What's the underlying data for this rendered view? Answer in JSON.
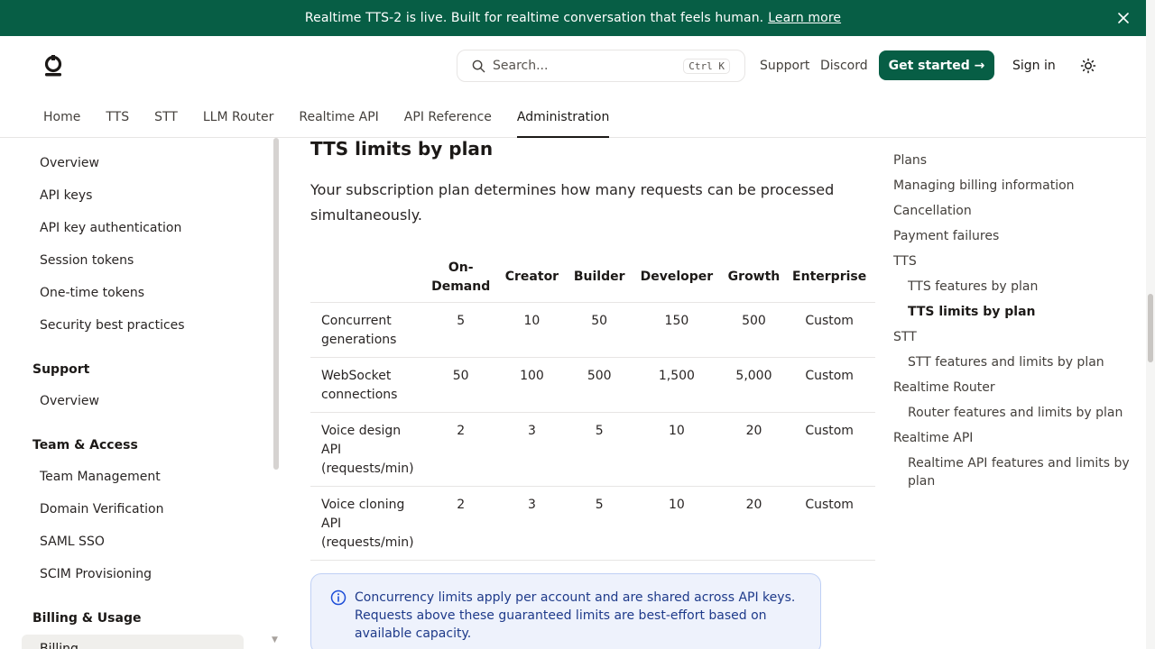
{
  "banner": {
    "text": "Realtime TTS-2 is live. Built for realtime conversation that feels human.",
    "link": "Learn more",
    "bg_color": "#075e45"
  },
  "header": {
    "search_placeholder": "Search...",
    "search_shortcut": "Ctrl K",
    "links": [
      "Support",
      "Discord"
    ],
    "cta": "Get started →",
    "sign_in": "Sign in",
    "tabs": [
      "Home",
      "TTS",
      "STT",
      "LLM Router",
      "Realtime API",
      "API Reference",
      "Administration"
    ],
    "active_tab": "Administration"
  },
  "sidebar": {
    "items_top": [
      "Overview",
      "API keys",
      "API key authentication",
      "Session tokens",
      "One-time tokens",
      "Security best practices"
    ],
    "support_head": "Support",
    "support_items": [
      "Overview"
    ],
    "team_head": "Team & Access",
    "team_items": [
      "Team Management",
      "Domain Verification",
      "SAML SSO",
      "SCIM Provisioning"
    ],
    "billing_head": "Billing & Usage",
    "billing_active": "Billing"
  },
  "main": {
    "heading": "TTS limits by plan",
    "intro": "Your subscription plan determines how many requests can be processed simultaneously.",
    "table": {
      "columns": [
        "",
        "On-Demand",
        "Creator",
        "Builder",
        "Developer",
        "Growth",
        "Enterprise"
      ],
      "rows": [
        [
          "Concurrent generations",
          "5",
          "10",
          "50",
          "150",
          "500",
          "Custom"
        ],
        [
          "WebSocket connections",
          "50",
          "100",
          "500",
          "1,500",
          "5,000",
          "Custom"
        ],
        [
          "Voice design API (requests/min)",
          "2",
          "3",
          "5",
          "10",
          "20",
          "Custom"
        ],
        [
          "Voice cloning API (requests/min)",
          "2",
          "3",
          "5",
          "10",
          "20",
          "Custom"
        ]
      ]
    },
    "note": "Concurrency limits apply per account and are shared across API keys. Requests above these guaranteed limits are best-effort based on available capacity."
  },
  "toc": {
    "items": [
      {
        "label": "Plans",
        "level": 1
      },
      {
        "label": "Managing billing information",
        "level": 1
      },
      {
        "label": "Cancellation",
        "level": 1
      },
      {
        "label": "Payment failures",
        "level": 1
      },
      {
        "label": "TTS",
        "level": 1
      },
      {
        "label": "TTS features by plan",
        "level": 2
      },
      {
        "label": "TTS limits by plan",
        "level": 2,
        "active": true
      },
      {
        "label": "STT",
        "level": 1
      },
      {
        "label": "STT features and limits by plan",
        "level": 2
      },
      {
        "label": "Realtime Router",
        "level": 1
      },
      {
        "label": "Router features and limits by plan",
        "level": 2
      },
      {
        "label": "Realtime API",
        "level": 1
      },
      {
        "label": "Realtime API features and limits by plan",
        "level": 2
      }
    ]
  }
}
